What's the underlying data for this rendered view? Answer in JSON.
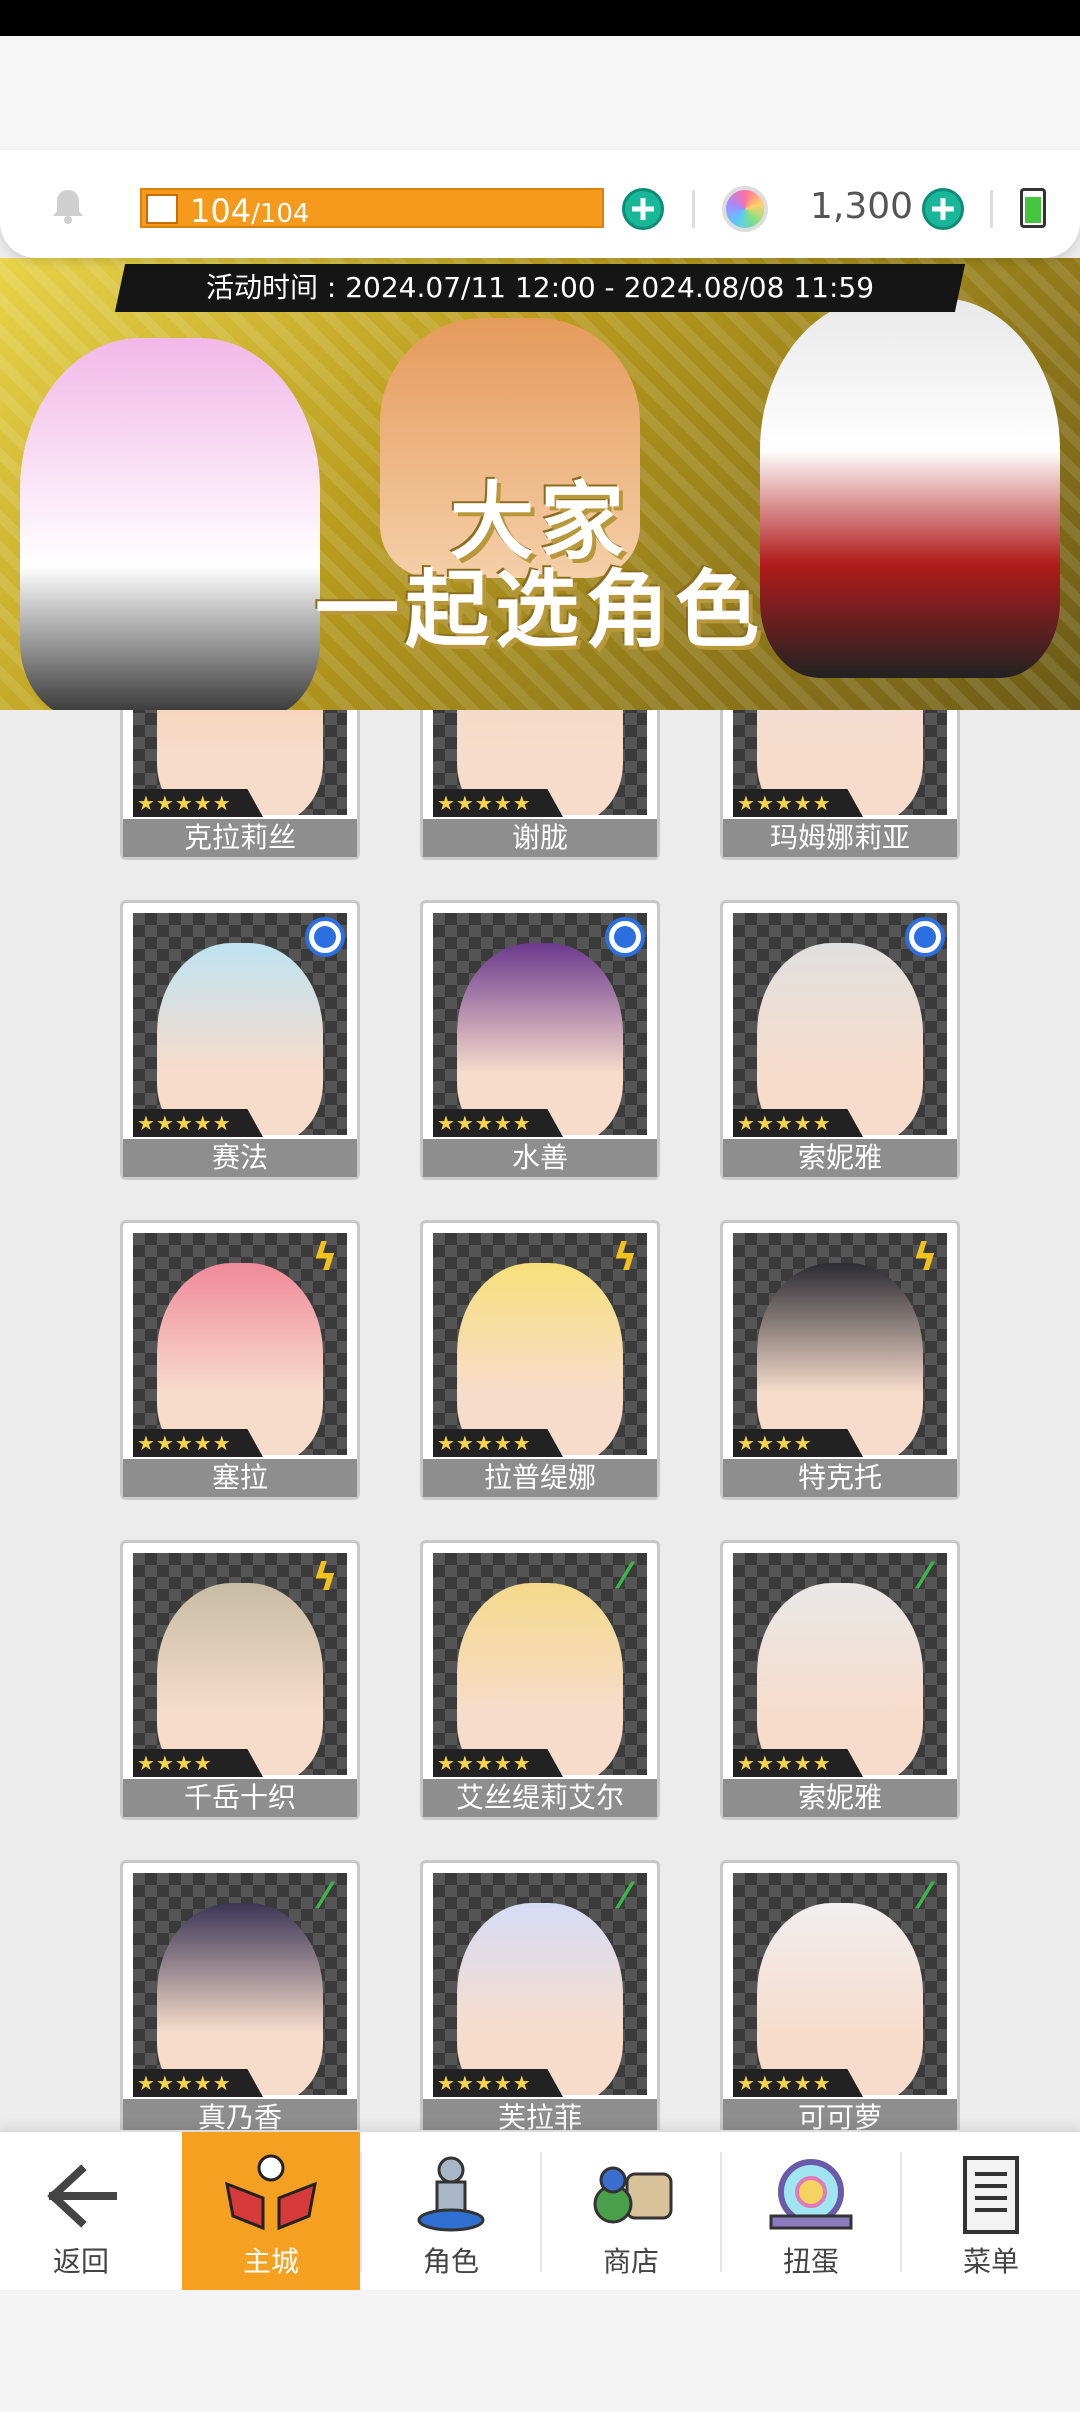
{
  "resource_bar": {
    "energy_current": "104",
    "energy_max": "/104",
    "energy_fraction": 1.0,
    "gems": "1,300",
    "energy_icon": "lightning-icon",
    "gem_icon": "rainbow-gem-icon"
  },
  "banner": {
    "event_time": "活动时间 : 2024.07/11 12:00 - 2024.08/08 11:59",
    "title_line1": "大家",
    "title_line2": "一起选角色"
  },
  "characters": [
    {
      "name": "克拉莉丝",
      "stars": "★★★★★",
      "attr": "none",
      "color": "#f3c9a0"
    },
    {
      "name": "谢胧",
      "stars": "★★★★★",
      "attr": "none",
      "color": "#f3d6c0"
    },
    {
      "name": "玛姆娜莉亚",
      "stars": "★★★★★",
      "attr": "none",
      "color": "#f1dede"
    },
    {
      "name": "赛法",
      "stars": "★★★★★",
      "attr": "water",
      "color": "#bfe3f2"
    },
    {
      "name": "水善",
      "stars": "★★★★★",
      "attr": "water",
      "color": "#6b3a8e"
    },
    {
      "name": "索妮雅",
      "stars": "★★★★★",
      "attr": "water",
      "color": "#e0e0e0"
    },
    {
      "name": "塞拉",
      "stars": "★★★★★",
      "attr": "bolt",
      "color": "#f08a9a"
    },
    {
      "name": "拉普缇娜",
      "stars": "★★★★★",
      "attr": "bolt",
      "color": "#f6e07a"
    },
    {
      "name": "特克托",
      "stars": "★★★★",
      "attr": "bolt",
      "color": "#2b2b33"
    },
    {
      "name": "千岳十织",
      "stars": "★★★★",
      "attr": "bolt",
      "color": "#c7bca4"
    },
    {
      "name": "艾丝缇莉艾尔",
      "stars": "★★★★★",
      "attr": "leaf",
      "color": "#f4d98b"
    },
    {
      "name": "索妮雅",
      "stars": "★★★★★",
      "attr": "leaf",
      "color": "#e8e8e8"
    },
    {
      "name": "真乃香",
      "stars": "★★★★★",
      "attr": "leaf",
      "color": "#3b3556"
    },
    {
      "name": "芙拉菲",
      "stars": "★★★★★",
      "attr": "leaf",
      "color": "#d6dcf6"
    },
    {
      "name": "可可萝",
      "stars": "★★★★★",
      "attr": "leaf",
      "color": "#f0eef0"
    }
  ],
  "nav": {
    "back": "返回",
    "main_city": "主城",
    "characters": "角色",
    "shop": "商店",
    "gacha": "扭蛋",
    "menu": "菜单"
  },
  "colors": {
    "accent": "#f5a021",
    "plus": "#19b79a",
    "water": "#2c6fe0",
    "bolt": "#f1c21b",
    "leaf": "#3fb64b"
  }
}
